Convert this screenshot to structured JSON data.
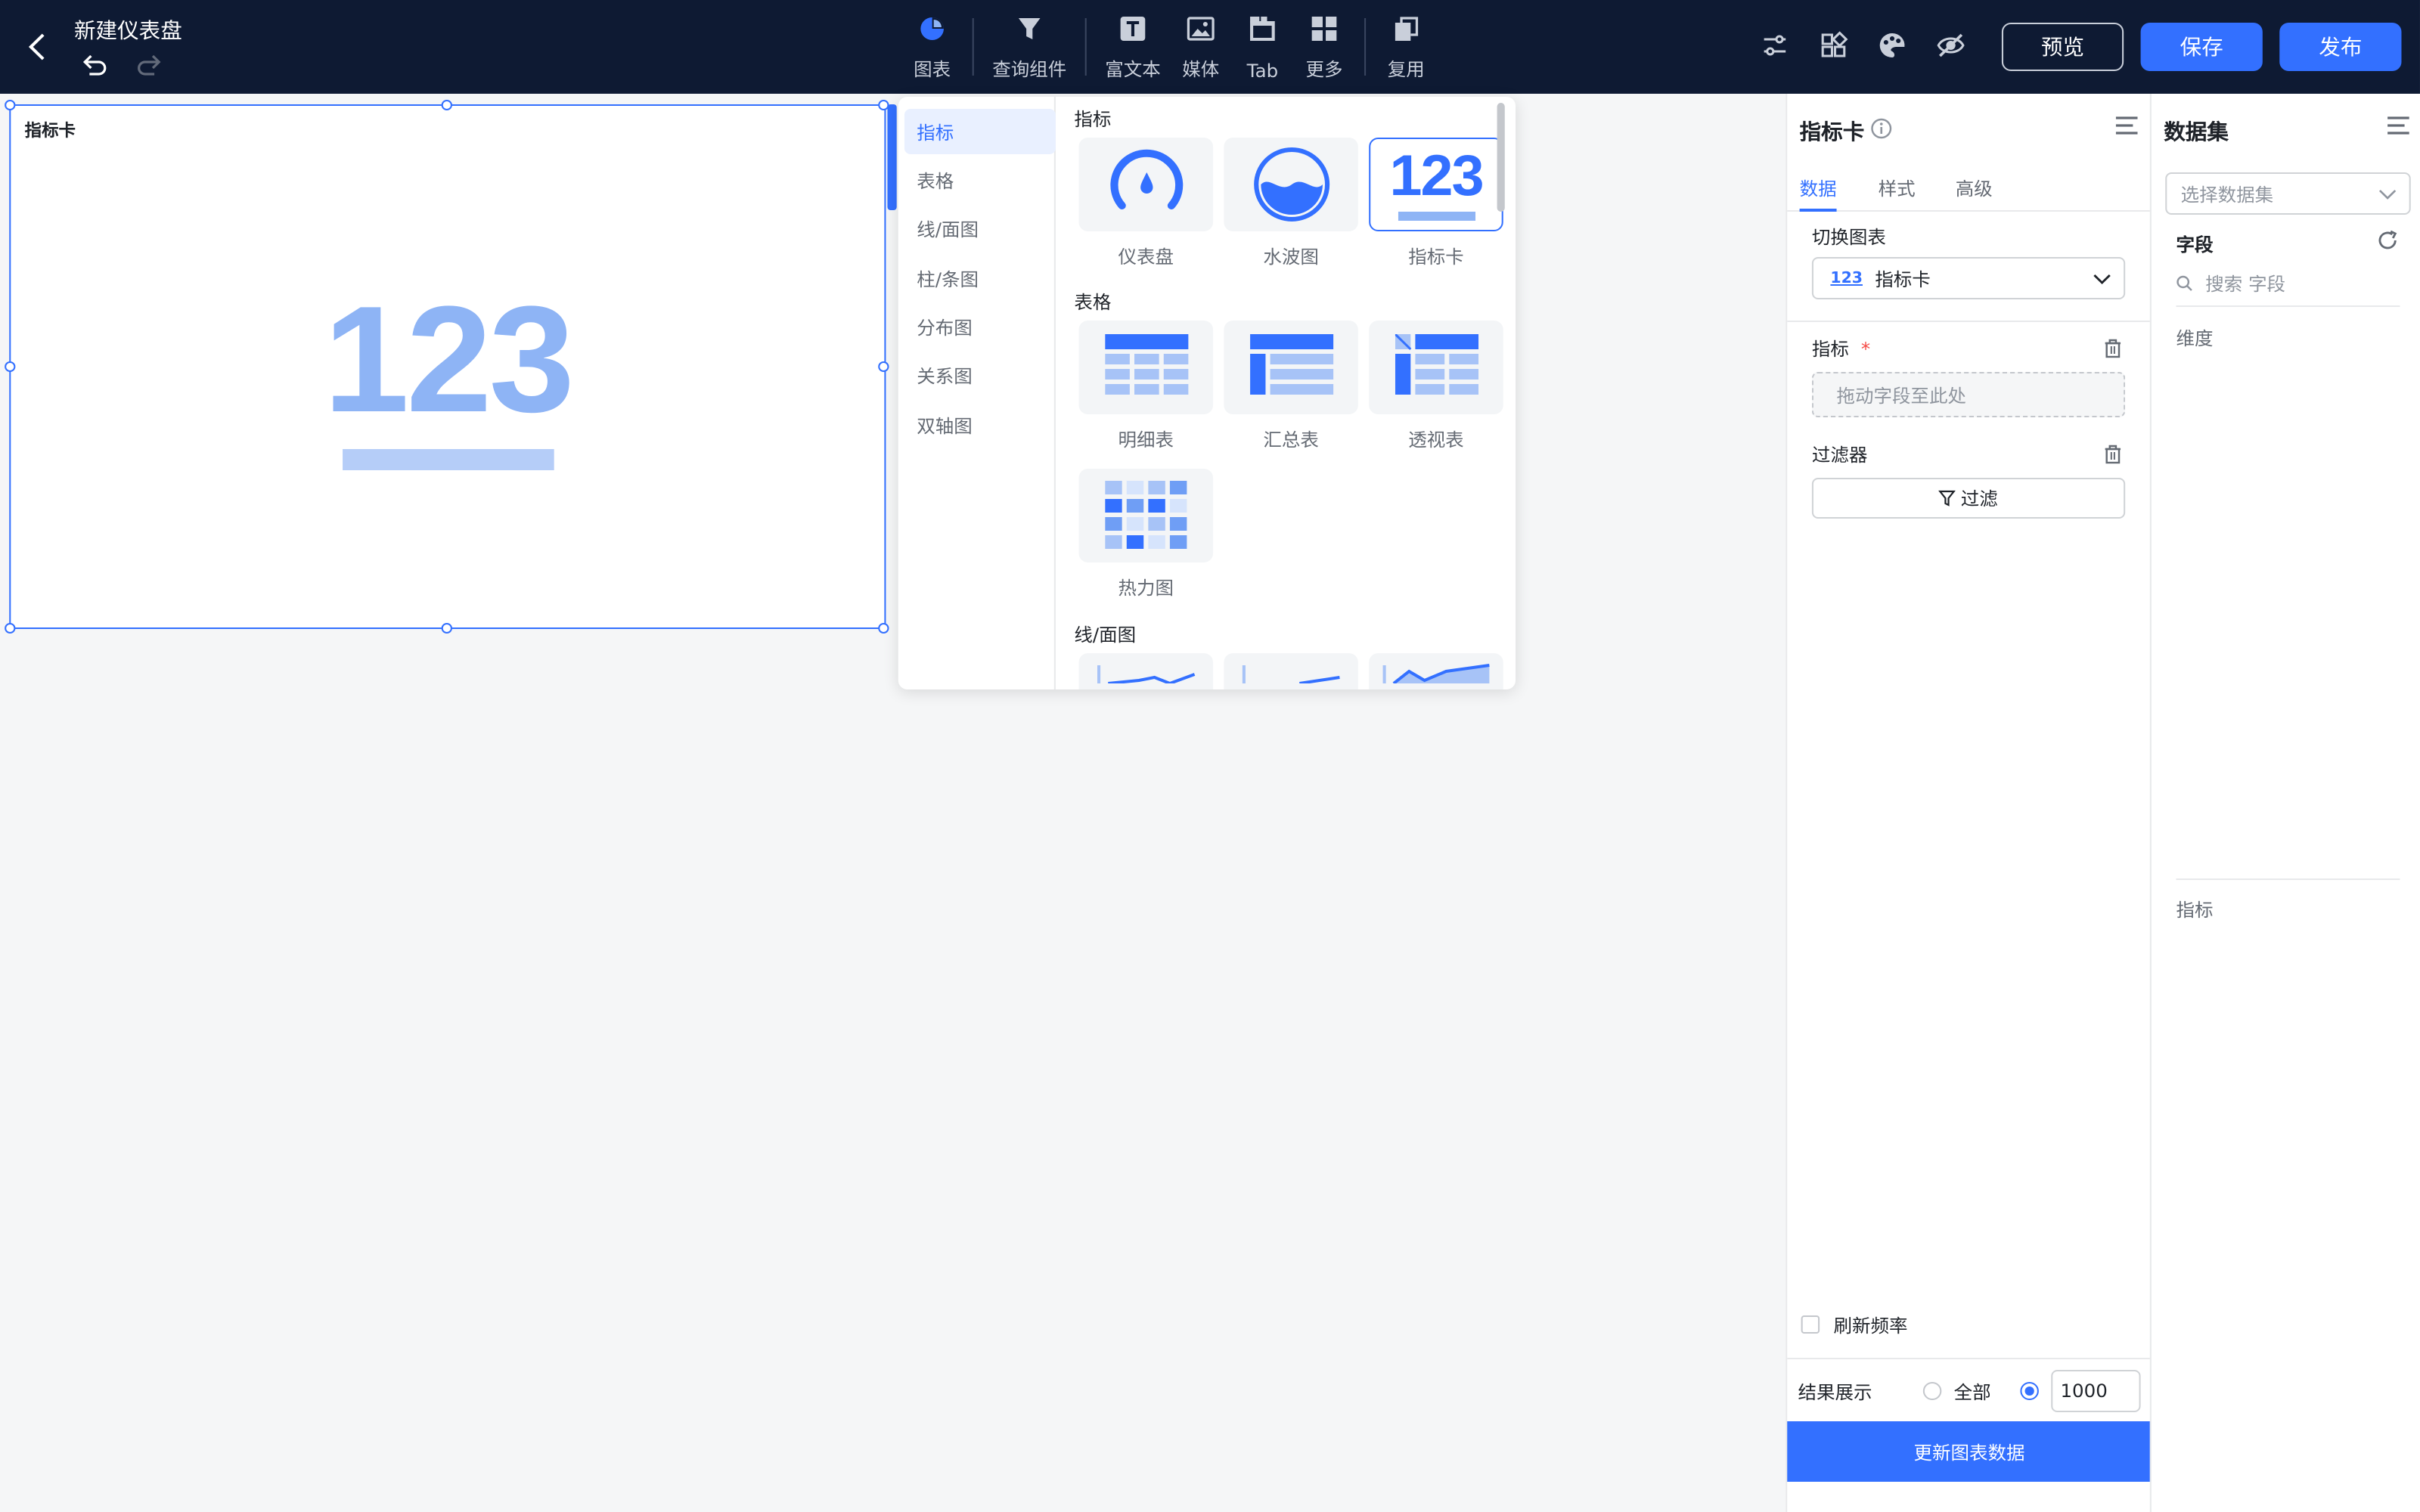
{
  "header": {
    "title": "新建仪表盘",
    "tools": [
      {
        "label": "图表",
        "icon": "pie-chart-icon"
      },
      {
        "label": "查询组件",
        "icon": "funnel-icon"
      },
      {
        "label": "富文本",
        "icon": "rich-text-icon"
      },
      {
        "label": "媒体",
        "icon": "image-icon"
      },
      {
        "label": "Tab",
        "icon": "tab-icon"
      },
      {
        "label": "更多",
        "icon": "grid-icon"
      },
      {
        "label": "复用",
        "icon": "copy-icon"
      }
    ],
    "preview_label": "预览",
    "save_label": "保存",
    "publish_label": "发布"
  },
  "card": {
    "title": "指标卡",
    "value": "123"
  },
  "picker": {
    "categories": [
      "指标",
      "表格",
      "线/面图",
      "柱/条图",
      "分布图",
      "关系图",
      "双轴图"
    ],
    "sections": {
      "indicator": "指标",
      "table": "表格",
      "line": "线/面图"
    },
    "indicator_items": [
      "仪表盘",
      "水波图",
      "指标卡"
    ],
    "table_items": [
      "明细表",
      "汇总表",
      "透视表",
      "热力图"
    ],
    "card_icon_text": "123"
  },
  "props": {
    "title": "指标卡",
    "tabs": [
      "数据",
      "样式",
      "高级"
    ],
    "switch_label": "切换图表",
    "switch_icon_text": "123",
    "switch_value": "指标卡",
    "metric_label": "指标",
    "required_mark": "*",
    "drop_placeholder": "拖动字段至此处",
    "filter_label": "过滤器",
    "filter_button": "过滤",
    "refresh_label": "刷新频率",
    "result_label": "结果展示",
    "result_all": "全部",
    "result_count": "1000",
    "update_button": "更新图表数据"
  },
  "dataset": {
    "title": "数据集",
    "select_placeholder": "选择数据集",
    "field_label": "字段",
    "search_placeholder": "搜索 字段",
    "dimension_label": "维度",
    "measure_label": "指标"
  },
  "colors": {
    "accent": "#3370ff",
    "header_bg": "#0e1a33"
  }
}
